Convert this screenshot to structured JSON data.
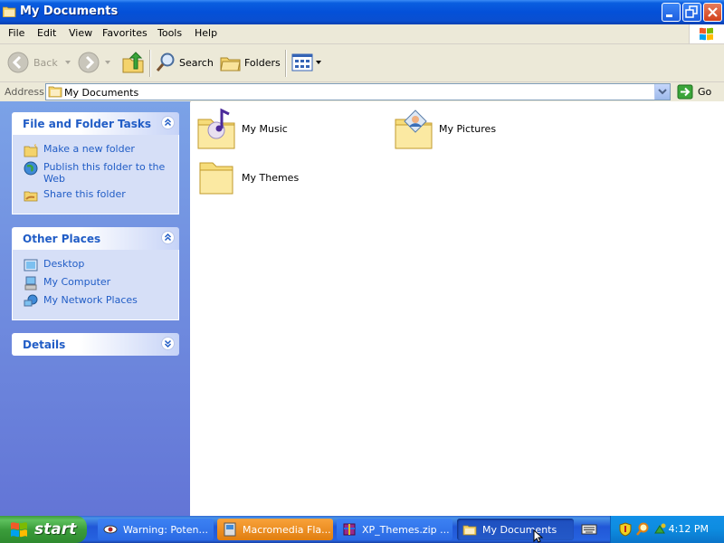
{
  "window": {
    "title": "My Documents"
  },
  "menu": {
    "items": [
      "File",
      "Edit",
      "View",
      "Favorites",
      "Tools",
      "Help"
    ]
  },
  "toolbar": {
    "back_label": "Back",
    "search_label": "Search",
    "folders_label": "Folders"
  },
  "address": {
    "label": "Address",
    "value": "My Documents",
    "go_label": "Go"
  },
  "left_pane": {
    "file_tasks": {
      "title": "File and Folder Tasks",
      "items": [
        "Make a new folder",
        "Publish this folder to the Web",
        "Share this folder"
      ]
    },
    "other_places": {
      "title": "Other Places",
      "items": [
        "Desktop",
        "My Computer",
        "My Network Places"
      ]
    },
    "details": {
      "title": "Details"
    }
  },
  "content": {
    "items": [
      "My Music",
      "My Pictures",
      "My Themes"
    ]
  },
  "taskbar": {
    "start_label": "start",
    "buttons": [
      "Warning: Poten...",
      "Macromedia Fla...",
      "XP_Themes.zip ...",
      "My Documents"
    ],
    "clock": "4:12 PM"
  },
  "colors": {
    "xp_blue": "#0a5ee0",
    "link_blue": "#215dc6",
    "pane_blue": "#6375d6",
    "start_green": "#3b9d3b",
    "tray_blue": "#0d8ce0"
  }
}
